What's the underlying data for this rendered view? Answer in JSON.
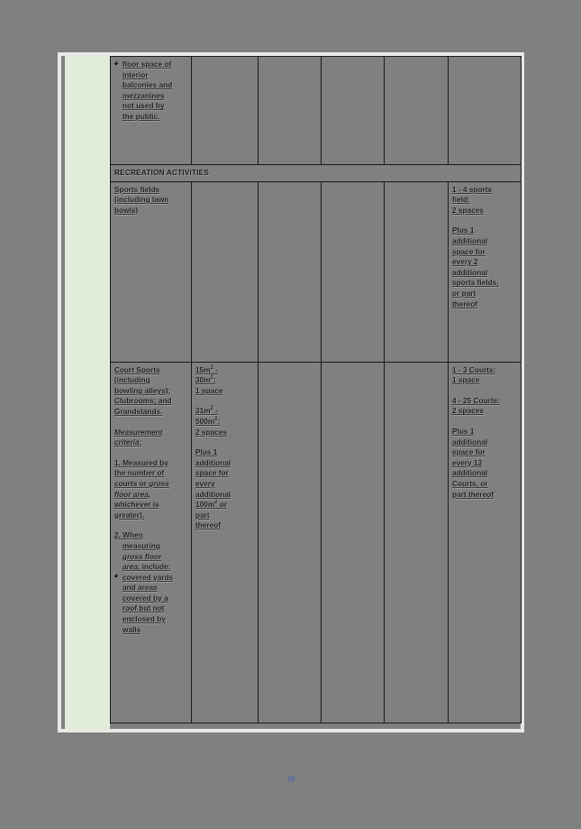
{
  "document": {
    "page_marker": "16",
    "accent_color": "#3b5fc0",
    "margin_color": "#e2ecdb",
    "page_background": "#808080"
  },
  "table": {
    "rows": [
      {
        "id": "floor-space-exclusions",
        "type": "data",
        "cells": [
          {
            "id": "floor-space-note",
            "lines": [
              {
                "text": "floor space of",
                "bullet": true
              },
              {
                "text": "interior",
                "indent": true
              },
              {
                "text": "balconies and",
                "indent": true
              },
              {
                "text": "mezzanines",
                "indent": true
              },
              {
                "text": "not used by",
                "indent": true
              },
              {
                "text": "the public.",
                "indent": true
              }
            ]
          },
          {
            "id": "col2",
            "lines": []
          },
          {
            "id": "col3",
            "lines": []
          },
          {
            "id": "col4",
            "lines": []
          },
          {
            "id": "col5",
            "lines": []
          },
          {
            "id": "col6",
            "lines": []
          }
        ]
      },
      {
        "id": "recreation-activities-header",
        "type": "section",
        "label": "RECREATION ACTIVITIES"
      },
      {
        "id": "sports-fields",
        "type": "data",
        "cells": [
          {
            "id": "sports-fields-name",
            "lines": [
              {
                "text": "Sports fields"
              },
              {
                "text": "(including lawn"
              },
              {
                "text": "bowls)"
              }
            ]
          },
          {
            "id": "col2",
            "lines": []
          },
          {
            "id": "col3",
            "lines": []
          },
          {
            "id": "col4",
            "lines": []
          },
          {
            "id": "col5",
            "lines": []
          },
          {
            "id": "sports-fields-requirement",
            "lines": [
              {
                "text": "1 - 4 sports"
              },
              {
                "text": "field:"
              },
              {
                "text": "2 spaces"
              },
              {
                "text": "Plus 1",
                "gap": true
              },
              {
                "text": "additional"
              },
              {
                "text": "space for"
              },
              {
                "text": "every 2"
              },
              {
                "text": "additional"
              },
              {
                "text": "sports fields,"
              },
              {
                "text": "or part"
              },
              {
                "text": "thereof"
              }
            ]
          }
        ]
      },
      {
        "id": "court-sports",
        "type": "data",
        "cells": [
          {
            "id": "court-sports-name",
            "lines": [
              {
                "text": "Court Sports"
              },
              {
                "text": "(including"
              },
              {
                "text": "bowling alleys);"
              },
              {
                "text": "Clubrooms; and"
              },
              {
                "text": "Grandstands."
              },
              {
                "text": "Measurement",
                "gap": true,
                "italic": true
              },
              {
                "text": "criteria:",
                "italic": true
              },
              {
                "text": "1. Measured by",
                "gap": true
              },
              {
                "text": "the number of"
              },
              {
                "text": "courts or gross"
              },
              {
                "text": "floor area,",
                "italic": true
              },
              {
                "text": "whichever is"
              },
              {
                "text": "greater)."
              },
              {
                "text": "2. When",
                "gap": true
              },
              {
                "text": "measuring",
                "indent": true
              },
              {
                "text": "gross floor",
                "indent": true,
                "italic": true
              },
              {
                "text": "area, include:",
                "indent": true
              },
              {
                "text": "covered yards",
                "bullet": true
              },
              {
                "text": "and areas",
                "indent": true
              },
              {
                "text": "covered by a",
                "indent": true
              },
              {
                "text": "roof but not",
                "indent": true
              },
              {
                "text": "enclosed by",
                "indent": true
              },
              {
                "text": "walls",
                "indent": true
              }
            ]
          },
          {
            "id": "court-sports-area-scale",
            "lines": [
              {
                "text": "15m",
                "sup": "2",
                "suffix": " -"
              },
              {
                "text": "30m",
                "sup": "2",
                "suffix": ":"
              },
              {
                "text": "1 space"
              },
              {
                "text": "31m",
                "sup": "2",
                "suffix": " -",
                "gap": true
              },
              {
                "text": "500m",
                "sup": "2",
                "suffix": ":"
              },
              {
                "text": "2 spaces"
              },
              {
                "text": "Plus 1",
                "gap": true
              },
              {
                "text": "additional"
              },
              {
                "text": "space for"
              },
              {
                "text": "every"
              },
              {
                "text": "additional"
              },
              {
                "text": "100m",
                "sup": "2",
                "suffix": " or"
              },
              {
                "text": "part"
              },
              {
                "text": "thereof"
              }
            ]
          },
          {
            "id": "col3",
            "lines": []
          },
          {
            "id": "col4",
            "lines": []
          },
          {
            "id": "col5",
            "lines": []
          },
          {
            "id": "court-sports-requirement",
            "lines": [
              {
                "text": "1 - 3 Courts:"
              },
              {
                "text": "1 space"
              },
              {
                "text": "4 - 25 Courts:",
                "gap": true
              },
              {
                "text": "2 spaces"
              },
              {
                "text": "Plus 1",
                "gap": true
              },
              {
                "text": "additional"
              },
              {
                "text": "space for"
              },
              {
                "text": "every 13"
              },
              {
                "text": "additional"
              },
              {
                "text": "Courts, or"
              },
              {
                "text": "part thereof"
              }
            ]
          }
        ]
      }
    ]
  }
}
